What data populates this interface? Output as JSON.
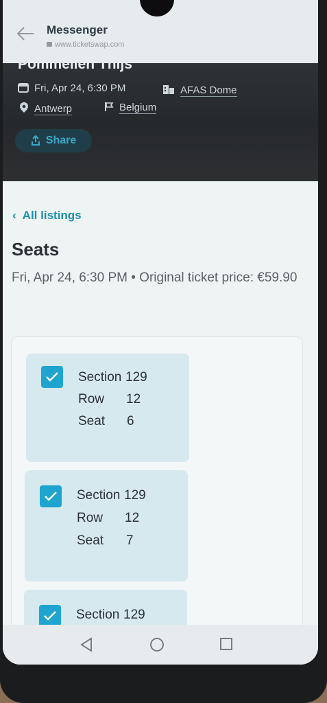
{
  "app": {
    "title": "Messenger",
    "url": "www.ticketswap.com"
  },
  "event": {
    "name": "Pommelien Thijs",
    "date": "Fri, Apr 24, 6:30 PM",
    "venue": "AFAS Dome",
    "city": "Antwerp",
    "country": "Belgium",
    "share_label": "Share"
  },
  "listing": {
    "back_label": "All listings",
    "title": "Seats",
    "subtitle": "Fri, Apr 24, 6:30 PM • Original ticket price: €59.90"
  },
  "tickets": [
    {
      "section_label": "Section",
      "section": "129",
      "row_label": "Row",
      "row": "12",
      "seat_label": "Seat",
      "seat": "6",
      "checked": true
    },
    {
      "section_label": "Section",
      "section": "129",
      "row_label": "Row",
      "row": "12",
      "seat_label": "Seat",
      "seat": "7",
      "checked": true
    },
    {
      "section_label": "Section",
      "section": "129",
      "checked": true
    }
  ],
  "colors": {
    "accent": "#1c8fb0",
    "checkbox": "#1ea4cf",
    "ticket_bg": "#d6e9ee",
    "hero_bg": "#2b2f32"
  },
  "icons": {
    "back": "arrow-left-icon",
    "calendar": "calendar-icon",
    "venue": "building-icon",
    "location": "map-pin-icon",
    "flag": "flag-icon",
    "share": "share-icon",
    "check": "checkmark-icon"
  }
}
